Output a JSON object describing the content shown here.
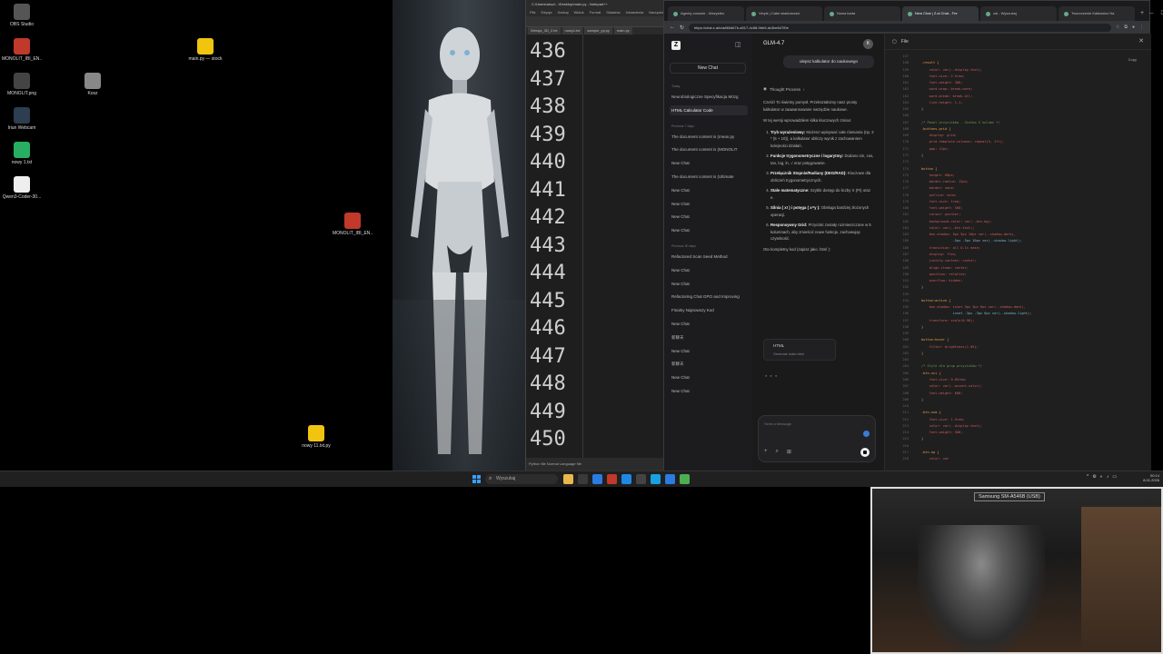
{
  "desktop": {
    "icons": [
      {
        "label": "OBS Studio",
        "color": "#555555"
      },
      {
        "label": "MONOLIT_IBI_EN...",
        "color": "#c0392b"
      },
      {
        "label": "MONOLIT.png",
        "color": "#444444"
      },
      {
        "label": "Iriun Webcam",
        "color": "#2c3e50"
      },
      {
        "label": "nowy 1.txt",
        "color": "#27ae60"
      },
      {
        "label": "Qwen3-Coder-30...",
        "color": "#eeeeee"
      },
      {
        "label": "main.py — stock",
        "color": "#f1c40f"
      },
      {
        "label": "Kosz",
        "color": "#888888"
      },
      {
        "label": "MONOLIT_IBI_EN...",
        "color": "#e6b422"
      },
      {
        "label": "nowy 11.txt.py",
        "color": "#f1c40f"
      },
      {
        "label": "MONOLIT_IBI_EN...",
        "color": "#c0392b"
      }
    ]
  },
  "notepad": {
    "title": "C:\\Users\\akoz\\...\\Desktop\\main.py - Notepad++",
    "menu": [
      "Plik",
      "Edycja",
      "Szukaj",
      "Widok",
      "Format",
      "Składnia",
      "Ustawienia",
      "Narzędzia"
    ],
    "tabs": [
      "Wersja_3D_2.txt",
      "nowy1.txt",
      "sample_py.py",
      "main.py"
    ],
    "line_numbers": [
      "436",
      "437",
      "438",
      "439",
      "440",
      "441",
      "442",
      "443",
      "444",
      "445",
      "446",
      "447",
      "448",
      "449",
      "450"
    ],
    "status": "Python file  Normal Language file"
  },
  "browser": {
    "tabs": [
      {
        "title": "Agenty console - Wszystko",
        "active": false
      },
      {
        "title": "Vinyls | Cake wiadomości",
        "active": false
      },
      {
        "title": "Nowa karta",
        "active": false
      },
      {
        "title": "New Chat | Z.ai Chat - Fre",
        "active": true
      },
      {
        "title": "zai - Wyszukaj",
        "active": false
      },
      {
        "title": "Tworzczenie Kalkulator Na",
        "active": false
      }
    ],
    "url": "https://chat.z.ai/c/a860d67b-a517-4c58-9bb9-dc3be647f0e",
    "new_tab_symbol": "+"
  },
  "sidebar": {
    "logo": "Z",
    "new_chat": "New Chat",
    "sections": [
      {
        "label": "Today",
        "items": [
          "Neurobiologiczne Specyfikacja Mózg",
          "HTML Calculator Code"
        ]
      },
      {
        "label": "Previous 7 days",
        "items": [
          "The document content is (mean.py",
          "The document content is (MONOLIT",
          "New Chat",
          "The document content is (Ultimate",
          "New Chat",
          "New Chat",
          "New Chat",
          "New Chat"
        ]
      },
      {
        "label": "Previous 30 days",
        "items": [
          "Refactored Scan Seed Method",
          "New Chat",
          "New Chat",
          "Refactoring Chat GPO and Improving",
          "Finalny Najnowszy Kod",
          "New Chat",
          "新聊天",
          "New Chat",
          "新聊天",
          "New Chat",
          "New Chat"
        ]
      }
    ],
    "active_item": "HTML Calculator Code"
  },
  "chat": {
    "model": "GLM-4.7",
    "avatar": "K",
    "user_message": "ulepsz kalkulator do naukowego",
    "thought_label": "Thought Process",
    "intro": "Cześć! To świetny pomysł. Przekształcimy nasz prosty kalkulator w zaawansowane narzędzie naukowe.",
    "intro2": "W tej wersji wprowadziłem kilka kluczowych zmian:",
    "points": [
      {
        "title": "Tryb wyrażeniowy:",
        "text": "Możesz wpisywać całe równania (np. 2 * (5 + 10)), a kalkulator obliczy wynik z zachowaniem kolejności działań."
      },
      {
        "title": "Funkcje trygonometryczne i logarytmy:",
        "text": "Dodano sin, cos, tan, log, ln, √ oraz potęgowanie."
      },
      {
        "title": "Przełącznik Stopnie/Radiany (DEG/RAD):",
        "text": "Kluczowe dla obliczeń trygonometrycznych."
      },
      {
        "title": "Stałe matematyczne:",
        "text": "Szybki dostęp do liczby π (Pi) oraz e."
      },
      {
        "title": "Silnia ( x! ) i potęga ( x^y ):",
        "text": "Obsługa bardziej złożonych operacji."
      },
      {
        "title": "Responsywny Grid:",
        "text": "Przyciski zostały rozmieszczone w 5 kolumnach, aby zmieścić nowe funkcje, zachowując czytelność."
      }
    ],
    "outro": "Oto kompletny kod (zapisz jako .html ):",
    "code_card": {
      "title": "HTML",
      "subtitle": "Generate index.html"
    },
    "composer_placeholder": "Send a Message"
  },
  "codepane": {
    "header": "File",
    "copy_label": "Copy",
    "lines": [
      {
        "n": "157",
        "t": "",
        "c": ""
      },
      {
        "n": "158",
        "t": ".result {",
        "c": "sel"
      },
      {
        "n": "159",
        "t": "    color: var(--display-text);",
        "c": "prop"
      },
      {
        "n": "160",
        "t": "    font-size: 2.5rem;",
        "c": "prop"
      },
      {
        "n": "161",
        "t": "    font-weight: 300;",
        "c": "prop"
      },
      {
        "n": "162",
        "t": "    word-wrap: break-word;",
        "c": "prop"
      },
      {
        "n": "163",
        "t": "    word-break: break-all;",
        "c": "prop"
      },
      {
        "n": "164",
        "t": "    line-height: 1.1;",
        "c": "prop"
      },
      {
        "n": "165",
        "t": "}",
        "c": "sel"
      },
      {
        "n": "166",
        "t": "",
        "c": ""
      },
      {
        "n": "167",
        "t": "/* Panel przycisków - Siatka 5 kolumn */",
        "c": "cmt"
      },
      {
        "n": "168",
        "t": ".buttons-grid {",
        "c": "sel"
      },
      {
        "n": "169",
        "t": "    display: grid;",
        "c": "prop"
      },
      {
        "n": "170",
        "t": "    grid-template-columns: repeat(5, 1fr);",
        "c": "prop"
      },
      {
        "n": "171",
        "t": "    gap: 12px;",
        "c": "prop"
      },
      {
        "n": "172",
        "t": "}",
        "c": "sel"
      },
      {
        "n": "173",
        "t": "",
        "c": ""
      },
      {
        "n": "174",
        "t": "button {",
        "c": "sel"
      },
      {
        "n": "175",
        "t": "    height: 60px;",
        "c": "prop"
      },
      {
        "n": "176",
        "t": "    border-radius: 12px;",
        "c": "prop"
      },
      {
        "n": "177",
        "t": "    border: none;",
        "c": "prop"
      },
      {
        "n": "178",
        "t": "    outline: none;",
        "c": "prop"
      },
      {
        "n": "179",
        "t": "    font-size: 1rem;",
        "c": "prop"
      },
      {
        "n": "180",
        "t": "    font-weight: 500;",
        "c": "prop"
      },
      {
        "n": "181",
        "t": "    cursor: pointer;",
        "c": "prop"
      },
      {
        "n": "182",
        "t": "    background-color: var(--btn-bg);",
        "c": "prop"
      },
      {
        "n": "183",
        "t": "    color: var(--btn-text);",
        "c": "prop"
      },
      {
        "n": "184",
        "t": "    box-shadow: 5px 5px 10px var(--shadow-dark),",
        "c": "prop"
      },
      {
        "n": "185",
        "t": "                -5px -5px 10px var(--shadow-light);",
        "c": "val"
      },
      {
        "n": "186",
        "t": "    transition: all 0.1s ease;",
        "c": "prop"
      },
      {
        "n": "187",
        "t": "    display: flex;",
        "c": "prop"
      },
      {
        "n": "188",
        "t": "    justify-content: center;",
        "c": "prop"
      },
      {
        "n": "189",
        "t": "    align-items: center;",
        "c": "prop"
      },
      {
        "n": "190",
        "t": "    position: relative;",
        "c": "prop"
      },
      {
        "n": "191",
        "t": "    overflow: hidden;",
        "c": "prop"
      },
      {
        "n": "192",
        "t": "}",
        "c": "sel"
      },
      {
        "n": "193",
        "t": "",
        "c": ""
      },
      {
        "n": "194",
        "t": "button:active {",
        "c": "sel"
      },
      {
        "n": "195",
        "t": "    box-shadow: inset 3px 3px 6px var(--shadow-dark),",
        "c": "prop"
      },
      {
        "n": "196",
        "t": "                inset -3px -3px 6px var(--shadow-light);",
        "c": "val"
      },
      {
        "n": "197",
        "t": "    transform: scale(0.98);",
        "c": "prop"
      },
      {
        "n": "198",
        "t": "}",
        "c": "sel"
      },
      {
        "n": "199",
        "t": "",
        "c": ""
      },
      {
        "n": "200",
        "t": "button:hover {",
        "c": "sel"
      },
      {
        "n": "201",
        "t": "    filter: brightness(1.05);",
        "c": "prop"
      },
      {
        "n": "202",
        "t": "}",
        "c": "sel"
      },
      {
        "n": "203",
        "t": "",
        "c": ""
      },
      {
        "n": "204",
        "t": "/* Style dla grup przycisków */",
        "c": "cmt"
      },
      {
        "n": "205",
        "t": ".btn-sci {",
        "c": "sel"
      },
      {
        "n": "206",
        "t": "    font-size: 0.85rem;",
        "c": "prop"
      },
      {
        "n": "207",
        "t": "    color: var(--accent-color);",
        "c": "prop"
      },
      {
        "n": "208",
        "t": "    font-weight: 600;",
        "c": "prop"
      },
      {
        "n": "209",
        "t": "}",
        "c": "sel"
      },
      {
        "n": "210",
        "t": "",
        "c": ""
      },
      {
        "n": "211",
        "t": ".btn-num {",
        "c": "sel"
      },
      {
        "n": "212",
        "t": "    font-size: 1.3rem;",
        "c": "prop"
      },
      {
        "n": "213",
        "t": "    color: var(--display-text);",
        "c": "prop"
      },
      {
        "n": "214",
        "t": "    font-weight: 500;",
        "c": "prop"
      },
      {
        "n": "215",
        "t": "}",
        "c": "sel"
      },
      {
        "n": "216",
        "t": "",
        "c": ""
      },
      {
        "n": "217",
        "t": ".btn-op {",
        "c": "sel"
      },
      {
        "n": "218",
        "t": "    color: var",
        "c": "prop"
      }
    ]
  },
  "taskbar": {
    "search_placeholder": "Wyszukaj",
    "app_colors": [
      "#e8b84a",
      "#3a3a3a",
      "#2b7be0",
      "#c0392b",
      "#1e88e5",
      "#444444",
      "#1aa0e0",
      "#2b7be0",
      "#4caf50"
    ],
    "tray": [
      "^",
      "⚙",
      "◐",
      "♪",
      "▭"
    ],
    "clock_time": "00:14",
    "clock_date": "8.01.2026"
  },
  "webcam": {
    "label": "Samsung SM-A546B (USB)"
  }
}
